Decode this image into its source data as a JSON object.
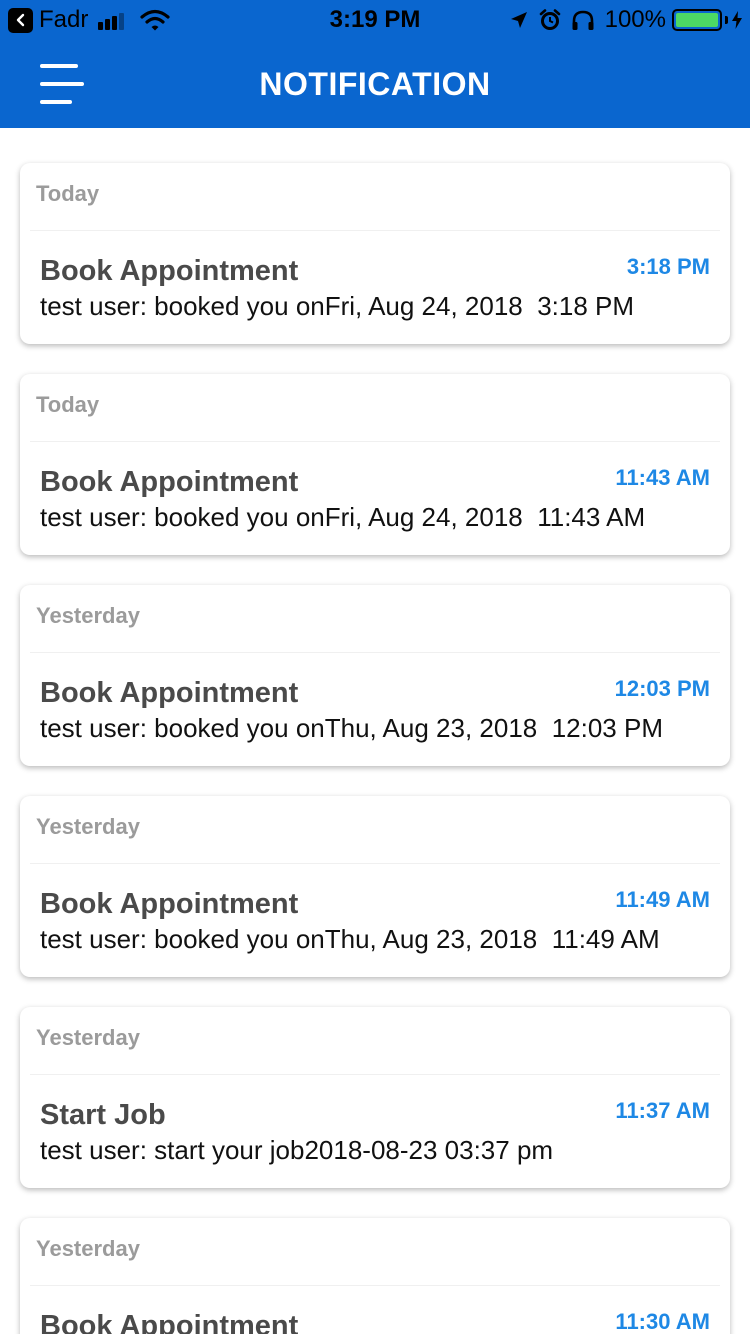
{
  "status_bar": {
    "back_app": "Fadr",
    "time": "3:19 PM",
    "battery": "100%",
    "battery_level": 1.0,
    "signal_bars": 3,
    "icons": [
      "back-icon",
      "signal-icon",
      "wifi-icon",
      "location-icon",
      "alarm-icon",
      "headphones-icon",
      "battery-icon",
      "charging-icon"
    ]
  },
  "header": {
    "title": "NOTIFICATION",
    "menu_icon": "hamburger-menu-icon"
  },
  "colors": {
    "header_bg": "#0a66cf",
    "time_accent": "#1e88e5",
    "day_label": "#9b9b9b",
    "title_text": "#4a4a4a"
  },
  "notifications": [
    {
      "day": "Today",
      "title": "Book Appointment",
      "time": "3:18 PM",
      "message": "test user: booked you onFri, Aug 24, 2018  3:18 PM"
    },
    {
      "day": "Today",
      "title": "Book Appointment",
      "time": "11:43 AM",
      "message": "test user: booked you onFri, Aug 24, 2018  11:43 AM"
    },
    {
      "day": "Yesterday",
      "title": "Book Appointment",
      "time": "12:03 PM",
      "message": "test user: booked you onThu, Aug 23, 2018  12:03 PM"
    },
    {
      "day": "Yesterday",
      "title": "Book Appointment",
      "time": "11:49 AM",
      "message": "test user: booked you onThu, Aug 23, 2018  11:49 AM"
    },
    {
      "day": "Yesterday",
      "title": "Start Job",
      "time": "11:37 AM",
      "message": "test user: start your job2018-08-23 03:37 pm"
    },
    {
      "day": "Yesterday",
      "title": "Book Appointment",
      "time": "11:30 AM",
      "message": ""
    }
  ]
}
